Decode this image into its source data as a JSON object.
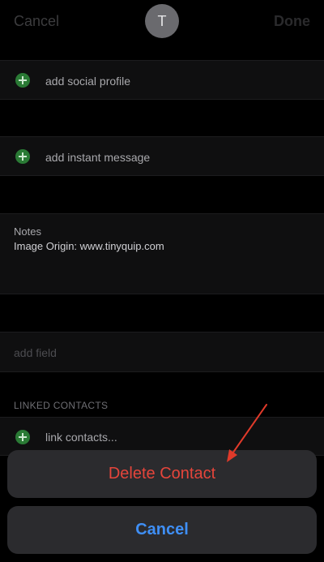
{
  "header": {
    "cancel_label": "Cancel",
    "done_label": "Done",
    "avatar_initial": "T"
  },
  "rows": {
    "social_profile": "add social profile",
    "instant_message": "add instant message",
    "add_field": "add field",
    "link_contacts": "link contacts..."
  },
  "notes": {
    "label": "Notes",
    "text": "Image Origin: www.tinyquip.com"
  },
  "linked_contacts_header": "LINKED CONTACTS",
  "action_sheet": {
    "delete_label": "Delete Contact",
    "cancel_label": "Cancel"
  },
  "colors": {
    "destructive": "#e5453b",
    "accent": "#3f8ff5",
    "annotation_arrow": "#e03a2a"
  }
}
